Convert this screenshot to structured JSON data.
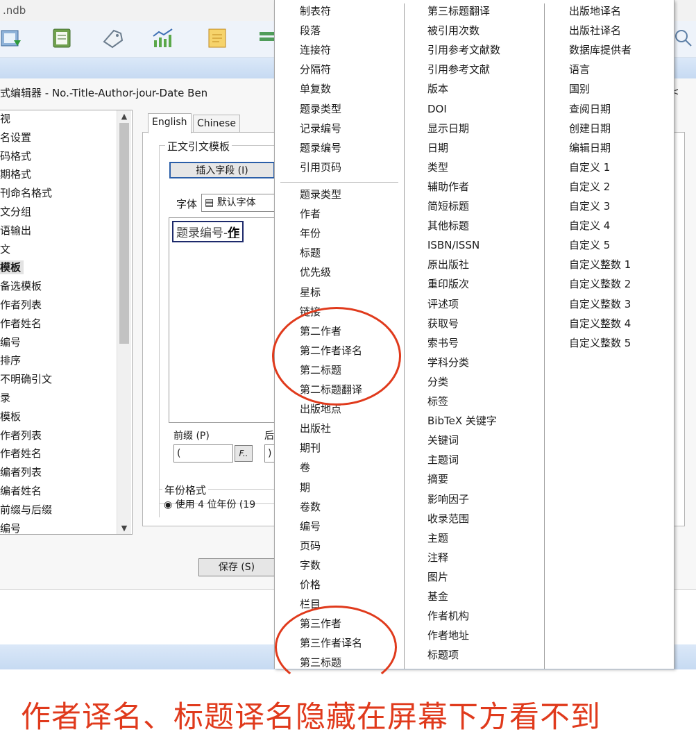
{
  "window": {
    "title": ".ndb",
    "toolbar_icons": [
      "import-icon",
      "clipboard-icon",
      "tag-icon",
      "chart-icon",
      "note-icon",
      "list-icon"
    ],
    "search_icon": "search-icon"
  },
  "editor": {
    "title": "式编辑器 - No.-Title-Author-jour-Date Ben",
    "close": "<",
    "tree": [
      {
        "label": "视",
        "selected": false
      },
      {
        "label": "名设置",
        "selected": false
      },
      {
        "label": "码格式",
        "selected": false
      },
      {
        "label": "期格式",
        "selected": false
      },
      {
        "label": "刊命名格式",
        "selected": false
      },
      {
        "label": "文分组",
        "selected": false
      },
      {
        "label": "语输出",
        "selected": false
      },
      {
        "label": "文",
        "selected": false
      },
      {
        "label": "模板",
        "selected": true
      },
      {
        "label": "备选模板",
        "selected": false
      },
      {
        "label": "作者列表",
        "selected": false
      },
      {
        "label": "作者姓名",
        "selected": false
      },
      {
        "label": "编号",
        "selected": false
      },
      {
        "label": "排序",
        "selected": false
      },
      {
        "label": "不明确引文",
        "selected": false
      },
      {
        "label": "录",
        "selected": false
      },
      {
        "label": "模板",
        "selected": false
      },
      {
        "label": "作者列表",
        "selected": false
      },
      {
        "label": "作者姓名",
        "selected": false
      },
      {
        "label": "编者列表",
        "selected": false
      },
      {
        "label": "编者姓名",
        "selected": false
      },
      {
        "label": "前缀与后缀",
        "selected": false
      },
      {
        "label": "编号",
        "selected": false
      }
    ],
    "tabs": [
      "English",
      "Chinese"
    ],
    "group_title": "正文引文模板",
    "insert_button": "插入字段 (I)",
    "font_label": "字体",
    "font_value": "默认字体",
    "template_text": "题录编号-",
    "template_bold": "作",
    "prefix_label": "前缀 (P)",
    "suffix_label": "后",
    "prefix_value": "(",
    "suffix_value": ")",
    "f_button": "F..",
    "year_group_title": "年份格式",
    "year_option": "使用 4 位年份 (19",
    "save_button": "保存 (S)"
  },
  "menu": {
    "col1_top": [
      "制表符",
      "段落",
      "连接符",
      "分隔符",
      "单复数",
      "题录类型",
      "记录编号",
      "题录编号",
      "引用页码"
    ],
    "col1_bottom": [
      "题录类型",
      "作者",
      "年份",
      "标题",
      "优先级",
      "星标",
      "链接",
      "第二作者",
      "第二作者译名",
      "第二标题",
      "第二标题翻译",
      "出版地点",
      "出版社",
      "期刊",
      "卷",
      "期",
      "卷数",
      "编号",
      "页码",
      "字数",
      "价格",
      "栏目",
      "第三作者",
      "第三作者译名",
      "第三标题"
    ],
    "col2": [
      "第三标题翻译",
      "被引用次数",
      "引用参考文献数",
      "引用参考文献",
      "版本",
      "DOI",
      "显示日期",
      "日期",
      "类型",
      "辅助作者",
      "简短标题",
      "其他标题",
      "ISBN/ISSN",
      "原出版社",
      "重印版次",
      "评述项",
      "获取号",
      "索书号",
      "学科分类",
      "分类",
      "标签",
      "BibTeX 关键字",
      "关键词",
      "主题词",
      "摘要",
      "影响因子",
      "收录范围",
      "主题",
      "注释",
      "图片",
      "基金",
      "作者机构",
      "作者地址",
      "标题项"
    ],
    "col3": [
      "出版地译名",
      "出版社译名",
      "数据库提供者",
      "语言",
      "国别",
      "查阅日期",
      "创建日期",
      "编辑日期",
      "自定义 1",
      "自定义 2",
      "自定义 3",
      "自定义 4",
      "自定义 5",
      "自定义整数 1",
      "自定义整数 2",
      "自定义整数 3",
      "自定义整数 4",
      "自定义整数 5"
    ]
  },
  "caption": "作者译名、标题译名隐藏在屏幕下方看不到",
  "colors": {
    "annotation": "#e03a1c",
    "accent": "#2a5ea8"
  }
}
